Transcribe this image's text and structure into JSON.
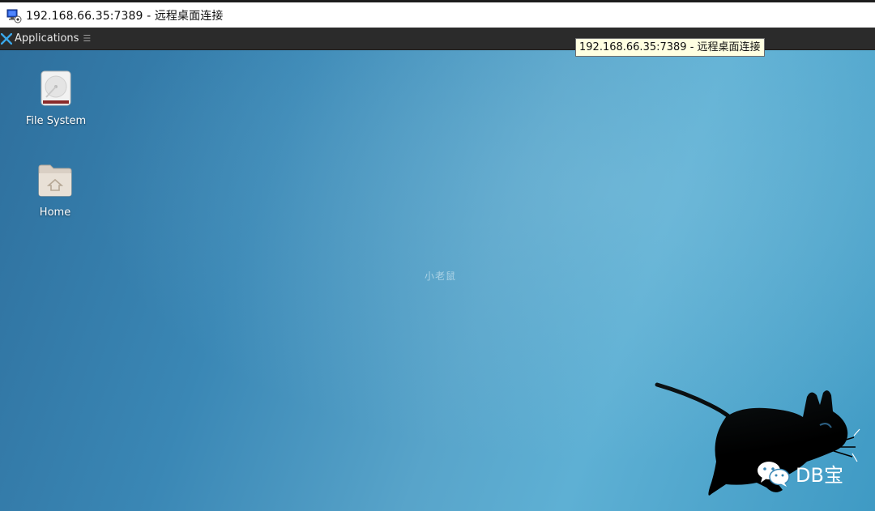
{
  "window": {
    "title": "192.168.66.35:7389 - 远程桌面连接"
  },
  "panel": {
    "applications_label": "Applications",
    "more_glyph": "☰"
  },
  "tooltip": {
    "text": "192.168.66.35:7389 - 远程桌面连接"
  },
  "desktop": {
    "icons": [
      {
        "label": "File System",
        "icon": "drive-icon"
      },
      {
        "label": "Home",
        "icon": "home-folder-icon"
      }
    ],
    "center_mark": "小老鼠",
    "watermark": "DB宝"
  },
  "colors": {
    "panel_bg": "#2b2b2b",
    "tooltip_bg": "#ffffe1",
    "desktop_blue": "#3a87b5"
  }
}
